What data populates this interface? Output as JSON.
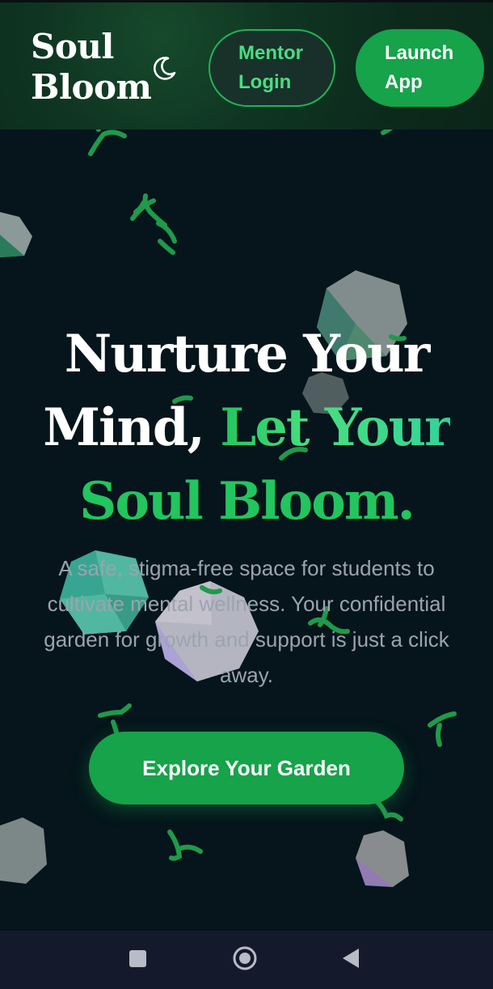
{
  "header": {
    "brand_line1": "Soul",
    "brand_line2": "Bloom",
    "theme_toggle_icon": "moon-icon",
    "mentor_login_label": "Mentor Login",
    "launch_app_label": "Launch App"
  },
  "hero": {
    "title_part1": "Nurture Your",
    "title_part2": "Mind,",
    "title_accent1": "Let Your",
    "title_accent2": "Soul Bloom.",
    "subtitle": "A safe, stigma-free space for students to cultivate mental wellness. Your confidential garden for growth and support is just a click away.",
    "cta_label": "Explore Your Garden"
  },
  "navbar": {
    "recents_icon": "square-icon",
    "home_icon": "circle-home-icon",
    "back_icon": "triangle-back-icon"
  },
  "colors": {
    "background": "#05151b",
    "accent": "#22c55e",
    "button_green": "#16a34a",
    "header_green": "#0f3522",
    "subtitle_gray": "#9ca3af"
  }
}
